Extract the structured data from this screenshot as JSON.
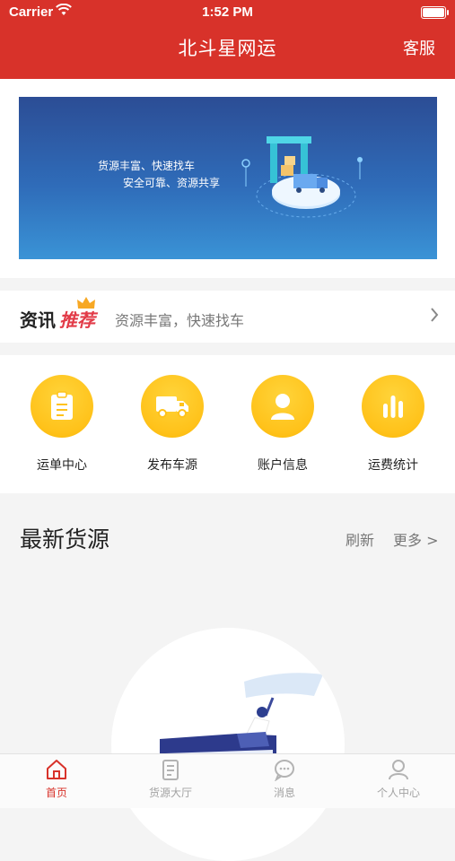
{
  "status": {
    "carrier": "Carrier",
    "time": "1:52 PM"
  },
  "nav": {
    "title": "北斗星网运",
    "service_label": "客服"
  },
  "banner": {
    "line1": "货源丰富、快速找车",
    "line2": "安全可靠、资源共享"
  },
  "news": {
    "tag_a": "资讯",
    "tag_b": "推荐",
    "text": "资源丰富，快速找车"
  },
  "features": [
    {
      "label": "运单中心",
      "icon": "clipboard-icon"
    },
    {
      "label": "发布车源",
      "icon": "truck-icon"
    },
    {
      "label": "账户信息",
      "icon": "user-icon"
    },
    {
      "label": "运费统计",
      "icon": "bar-chart-icon"
    }
  ],
  "latest": {
    "title": "最新货源",
    "refresh": "刷新",
    "more": "更多 >"
  },
  "tabs": [
    {
      "label": "首页",
      "icon": "home-icon",
      "active": true
    },
    {
      "label": "货源大厅",
      "icon": "document-icon",
      "active": false
    },
    {
      "label": "消息",
      "icon": "message-icon",
      "active": false
    },
    {
      "label": "个人中心",
      "icon": "person-icon",
      "active": false
    }
  ],
  "colors": {
    "brand": "#d8322a",
    "accent_yellow": "#ffc21a",
    "tag_pink": "#e23b48"
  }
}
